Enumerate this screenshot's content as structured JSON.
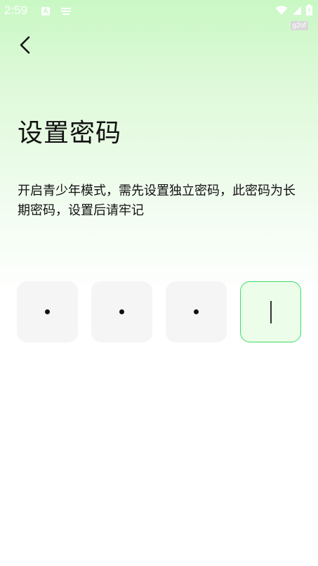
{
  "status_bar": {
    "time": "2:59",
    "icons": [
      "app-notification-icon",
      "keyboard-icon",
      "wifi-icon",
      "signal-icon",
      "battery-icon"
    ]
  },
  "debug_tag": "g2of",
  "header": {
    "back_icon": "chevron-left-icon"
  },
  "title": "设置密码",
  "description": "开启青少年模式，需先设置独立密码，此密码为长期密码，设置后请牢记",
  "pin": {
    "length": 4,
    "filled": 3,
    "active_index": 3
  },
  "colors": {
    "accent": "#3ddc6a",
    "background_top": "#c9f8c4",
    "pin_box": "#f5f5f5"
  }
}
